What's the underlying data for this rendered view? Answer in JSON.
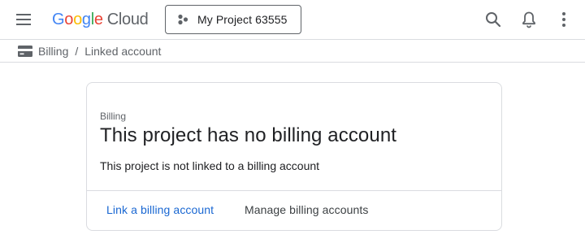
{
  "header": {
    "menu_icon": "hamburger-menu-icon",
    "logo": {
      "brand": "Google",
      "product": "Cloud"
    },
    "project_picker": {
      "label": "My Project 63555",
      "icon": "project-hub-icon"
    },
    "actions": [
      "search-icon",
      "notifications-bell-icon",
      "more-vert-icon"
    ]
  },
  "breadcrumb": {
    "icon": "billing-card-icon",
    "items": [
      "Billing",
      "Linked account"
    ],
    "separator": "/"
  },
  "card": {
    "eyebrow": "Billing",
    "title": "This project has no billing account",
    "description": "This project is not linked to a billing account",
    "actions": {
      "link_label": "Link a billing account",
      "manage_label": "Manage billing accounts"
    }
  },
  "colors": {
    "link_blue": "#1967d2",
    "text_primary": "#202124",
    "text_secondary": "#5f6368",
    "divider": "#dadce0",
    "google_blue": "#4285f4",
    "google_red": "#ea4335",
    "google_yellow": "#fbbc04",
    "google_green": "#34a853"
  }
}
